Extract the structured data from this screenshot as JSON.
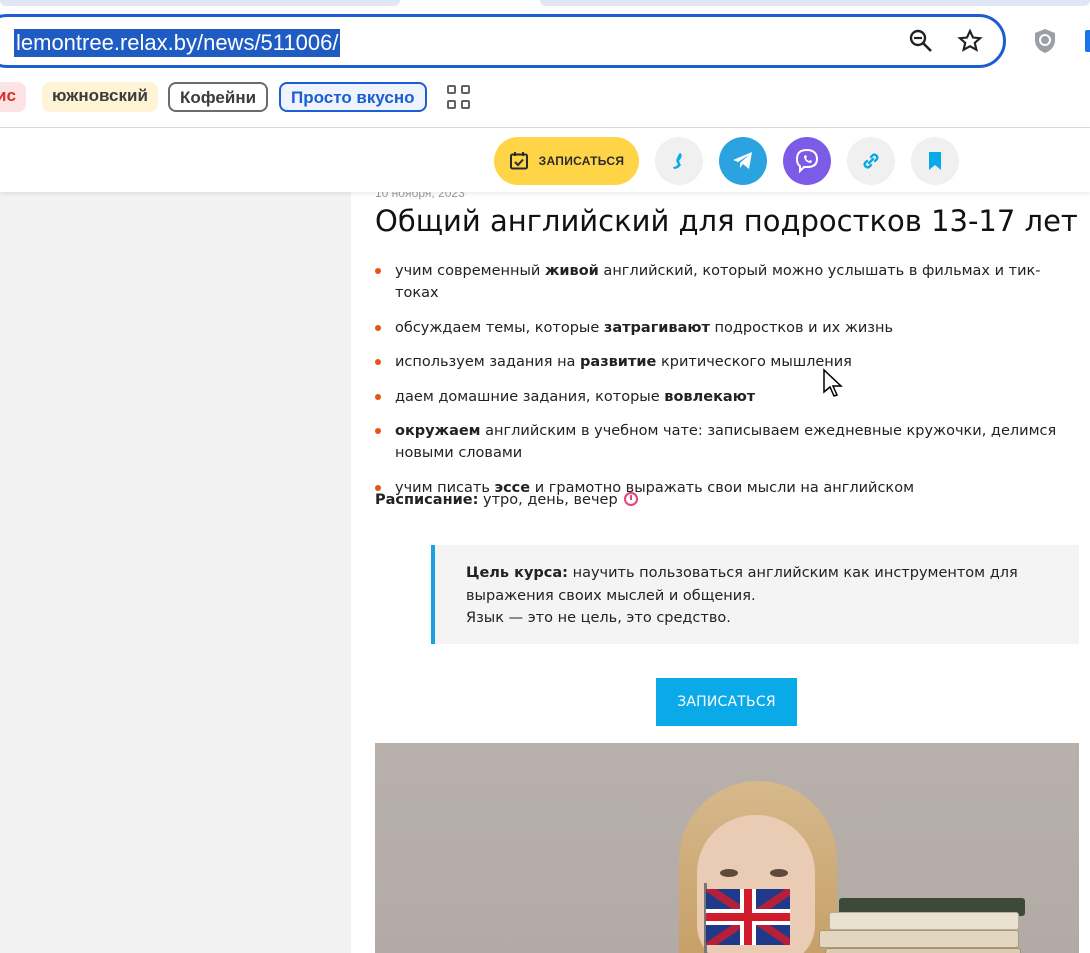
{
  "browser": {
    "url": "lemontree.relax.by/news/511006/",
    "bookmarks": [
      {
        "label": "ис"
      },
      {
        "label": "южновский"
      },
      {
        "label": "Кофейни"
      },
      {
        "label": "Просто вкусно"
      }
    ]
  },
  "header": {
    "signup_label": "ЗАПИСАТЬСЯ",
    "colors": {
      "signup_bg": "#ffd447",
      "telegram": "#2aa3e0",
      "viber": "#7c5ce6"
    }
  },
  "article": {
    "date": "10 ноября, 2023",
    "title": "Общий английский для подростков 13-17 лет",
    "bullets": [
      {
        "pre": "учим современный ",
        "bold": "живой",
        "post": " английский, который можно услышать в фильмах и тик-токах"
      },
      {
        "pre": "обсуждаем темы, которые ",
        "bold": "затрагивают",
        "post": " подростков и их жизнь"
      },
      {
        "pre": "используем задания на ",
        "bold": "развитие",
        "post": " критического мышления"
      },
      {
        "pre": "даем домашние задания, которые ",
        "bold": "вовлекают",
        "post": ""
      },
      {
        "pre": "",
        "bold": "окружаем",
        "post": " английским в учебном чате: записываем ежедневные кружочки, делимся новыми словами"
      },
      {
        "pre": "учим писать ",
        "bold": "эссе",
        "post": " и грамотно выражать свои мысли на английском"
      }
    ],
    "schedule_label": "Расписание:",
    "schedule_value": " утро, день, вечер",
    "goal_label": "Цель курса:",
    "goal_text": " научить пользоваться английским как инструментом для выражения своих мыслей и общения.",
    "goal_note": "Язык — это не цель, это средство.",
    "signup_button": "ЗАПИСАТЬСЯ",
    "accent_color": "#0aa9e8"
  }
}
